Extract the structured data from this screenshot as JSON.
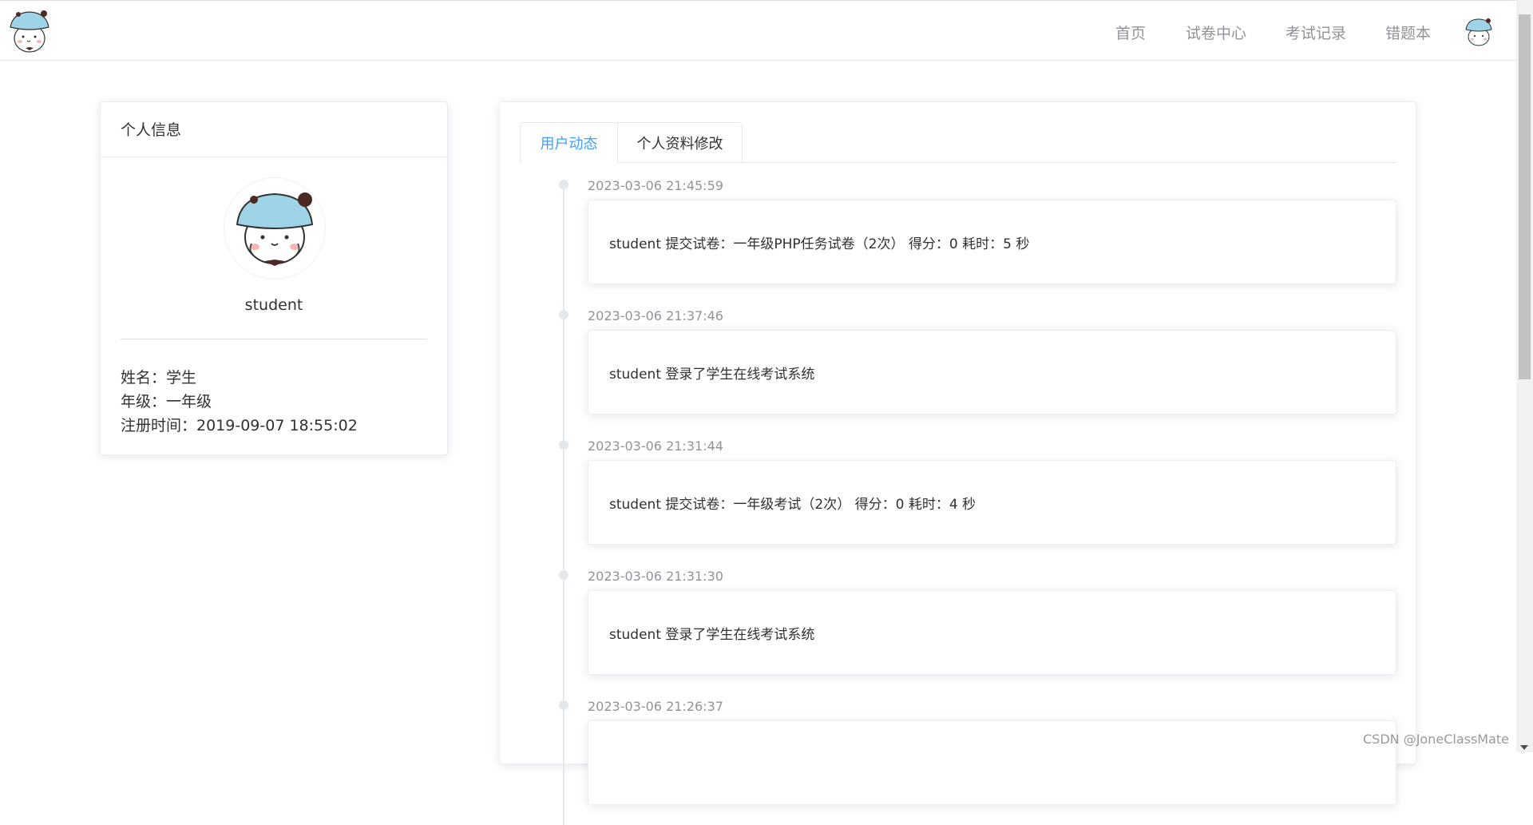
{
  "header": {
    "nav": [
      "首页",
      "试卷中心",
      "考试记录",
      "错题本"
    ]
  },
  "profile": {
    "title": "个人信息",
    "username": "student",
    "name_line": "姓名：学生",
    "grade_line": "年级：一年级",
    "register_line": "注册时间：2019-09-07 18:55:02"
  },
  "tabs": [
    "用户动态",
    "个人资料修改"
  ],
  "timeline": [
    {
      "time": "2023-03-06 21:45:59",
      "text": "student 提交试卷：一年级PHP任务试卷（2次） 得分：0 耗时：5 秒"
    },
    {
      "time": "2023-03-06 21:37:46",
      "text": "student 登录了学生在线考试系统"
    },
    {
      "time": "2023-03-06 21:31:44",
      "text": "student 提交试卷：一年级考试（2次） 得分：0 耗时：4 秒"
    },
    {
      "time": "2023-03-06 21:31:30",
      "text": "student 登录了学生在线考试系统"
    },
    {
      "time": "2023-03-06 21:26:37",
      "text": ""
    }
  ],
  "watermark": "CSDN @JoneClassMate",
  "colors": {
    "accent": "#409eff",
    "muted": "#909399",
    "text": "#303133"
  }
}
